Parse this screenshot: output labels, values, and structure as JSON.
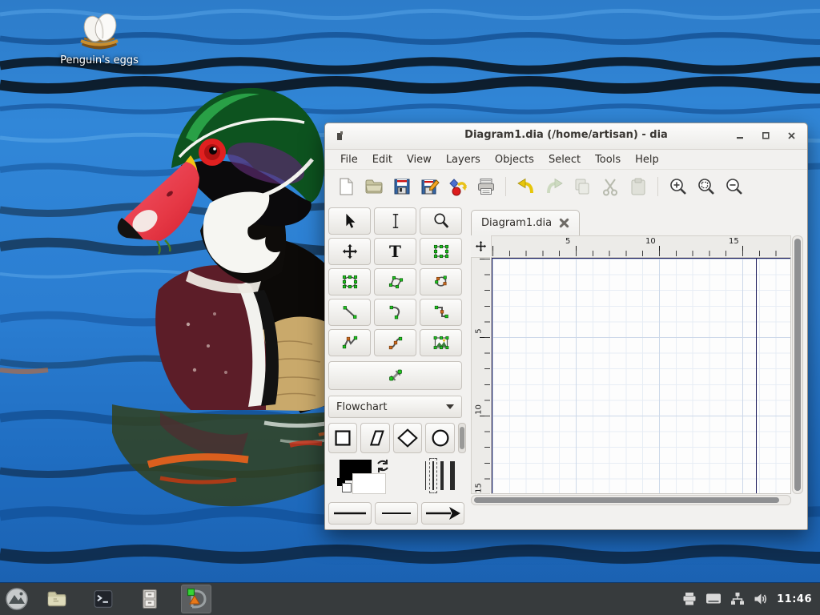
{
  "desktop": {
    "icon_label": "Penguin's eggs"
  },
  "taskbar": {
    "clock": "11:46",
    "apps": [
      "app-menu",
      "file-manager",
      "terminal",
      "file-cabinet",
      "dia"
    ]
  },
  "window": {
    "title": "Diagram1.dia (/home/artisan) - dia",
    "menus": [
      "File",
      "Edit",
      "View",
      "Layers",
      "Objects",
      "Select",
      "Tools",
      "Help"
    ],
    "toolbar_icons": [
      "new",
      "open",
      "save",
      "save-as",
      "export",
      "print",
      "undo",
      "redo",
      "copy",
      "cut",
      "paste",
      "zoom-in",
      "zoom-fit",
      "zoom-out"
    ],
    "toolbox": {
      "tools": [
        "modify",
        "textedit",
        "magnify",
        "scroll",
        "text",
        "box",
        "ellipse",
        "polygon",
        "beziergon",
        "line",
        "arc",
        "zigzagline",
        "polyline",
        "bezierline",
        "image",
        "outline"
      ],
      "text_tool_glyph": "T",
      "sheet_selector": "Flowchart",
      "shapes": [
        "box",
        "parallelogram",
        "diamond",
        "ellipse"
      ]
    },
    "tab_label": "Diagram1.dia",
    "rulers": {
      "h": [
        "5",
        "10",
        "15"
      ],
      "v": [
        "5",
        "10",
        "15"
      ]
    },
    "colors": {
      "foreground": "#000000",
      "background": "#ffffff",
      "page_border": "#1d1d5e",
      "grid_minor": "#e7edf5",
      "grid_major": "#ccd8e9",
      "handle_green": "#1ec81e",
      "handle_orange": "#cc6a1e"
    }
  }
}
